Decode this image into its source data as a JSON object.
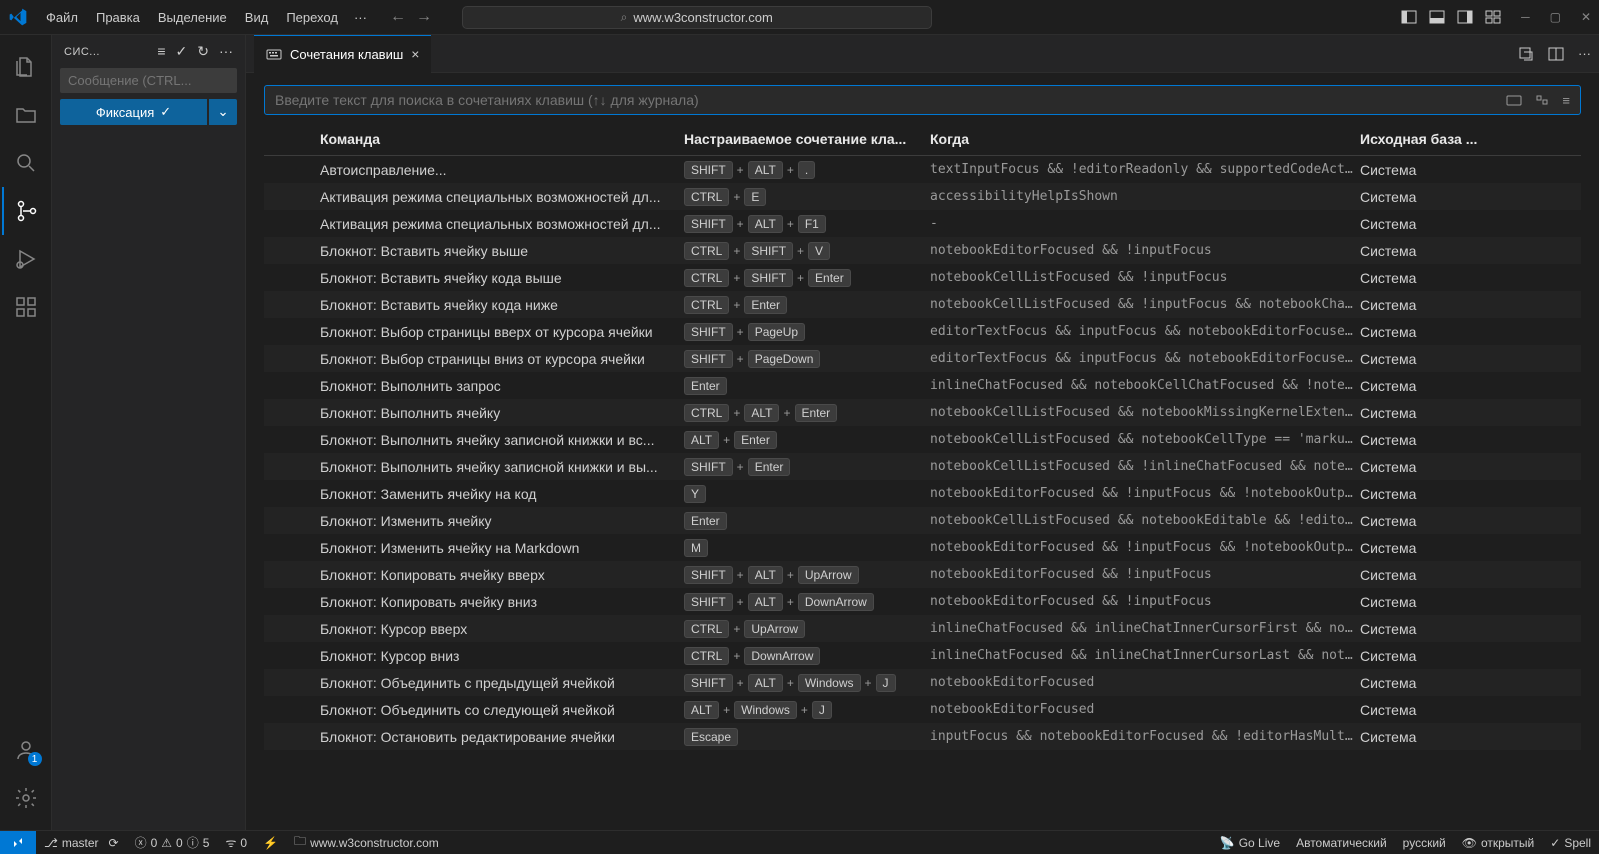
{
  "titlebar": {
    "menu": [
      "Файл",
      "Правка",
      "Выделение",
      "Вид",
      "Переход"
    ],
    "search_text": "www.w3constructor.com"
  },
  "sidebar": {
    "title": "СИС...",
    "message_placeholder": "Сообщение (CTRL...",
    "commit_label": "Фиксация"
  },
  "tab": {
    "label": "Сочетания клавиш"
  },
  "kb_search": {
    "placeholder": "Введите текст для поиска в сочетаниях клавиш (↑↓ для журнала)"
  },
  "headers": {
    "command": "Команда",
    "keybinding": "Настраиваемое сочетание кла...",
    "when": "Когда",
    "source": "Исходная база ..."
  },
  "src_label": "Система",
  "rows": [
    {
      "cmd": "Автоисправление...",
      "keys": [
        "SHIFT",
        "ALT",
        "."
      ],
      "when": "textInputFocus && !editorReadonly && supportedCodeAction..."
    },
    {
      "cmd": "Активация режима специальных возможностей дл...",
      "keys": [
        "CTRL",
        "E"
      ],
      "when": "accessibilityHelpIsShown"
    },
    {
      "cmd": "Активация режима специальных возможностей дл...",
      "keys": [
        "SHIFT",
        "ALT",
        "F1"
      ],
      "when": "-"
    },
    {
      "cmd": "Блокнот: Вставить ячейку выше",
      "keys": [
        "CTRL",
        "SHIFT",
        "V"
      ],
      "when": "notebookEditorFocused && !inputFocus"
    },
    {
      "cmd": "Блокнот: Вставить ячейку кода выше",
      "keys": [
        "CTRL",
        "SHIFT",
        "Enter"
      ],
      "when": "notebookCellListFocused && !inputFocus"
    },
    {
      "cmd": "Блокнот: Вставить ячейку кода ниже",
      "keys": [
        "CTRL",
        "Enter"
      ],
      "when": "notebookCellListFocused && !inputFocus && notebookChatOu..."
    },
    {
      "cmd": "Блокнот: Выбор страницы вверх от курсора ячейки",
      "keys": [
        "SHIFT",
        "PageUp"
      ],
      "when": "editorTextFocus && inputFocus && notebookEditorFocused &..."
    },
    {
      "cmd": "Блокнот: Выбор страницы вниз от курсора ячейки",
      "keys": [
        "SHIFT",
        "PageDown"
      ],
      "when": "editorTextFocus && inputFocus && notebookEditorFocused &..."
    },
    {
      "cmd": "Блокнот: Выполнить запрос",
      "keys": [
        "Enter"
      ],
      "when": "inlineChatFocused && notebookCellChatFocused && !noteboo..."
    },
    {
      "cmd": "Блокнот: Выполнить ячейку",
      "keys": [
        "CTRL",
        "ALT",
        "Enter"
      ],
      "when": "notebookCellListFocused && notebookMissingKernelExtensio..."
    },
    {
      "cmd": "Блокнот: Выполнить ячейку записной книжки и вс...",
      "keys": [
        "ALT",
        "Enter"
      ],
      "when": "notebookCellListFocused && notebookCellType == 'markup' ..."
    },
    {
      "cmd": "Блокнот: Выполнить ячейку записной книжки и вы...",
      "keys": [
        "SHIFT",
        "Enter"
      ],
      "when": "notebookCellListFocused && !inlineChatFocused && noteboo..."
    },
    {
      "cmd": "Блокнот: Заменить ячейку на код",
      "keys": [
        "Y"
      ],
      "when": "notebookEditorFocused && !inputFocus && !notebookOutputF..."
    },
    {
      "cmd": "Блокнот: Изменить ячейку",
      "keys": [
        "Enter"
      ],
      "when": "notebookCellListFocused && notebookEditable && !editorHo..."
    },
    {
      "cmd": "Блокнот: Изменить ячейку на Markdown",
      "keys": [
        "M"
      ],
      "when": "notebookEditorFocused && !inputFocus && !notebookOutputF..."
    },
    {
      "cmd": "Блокнот: Копировать ячейку вверх",
      "keys": [
        "SHIFT",
        "ALT",
        "UpArrow"
      ],
      "when": "notebookEditorFocused && !inputFocus"
    },
    {
      "cmd": "Блокнот: Копировать ячейку вниз",
      "keys": [
        "SHIFT",
        "ALT",
        "DownArrow"
      ],
      "when": "notebookEditorFocused && !inputFocus"
    },
    {
      "cmd": "Блокнот: Курсор вверх",
      "keys": [
        "CTRL",
        "UpArrow"
      ],
      "when": "inlineChatFocused && inlineChatInnerCursorFirst && noteb..."
    },
    {
      "cmd": "Блокнот: Курсор вниз",
      "keys": [
        "CTRL",
        "DownArrow"
      ],
      "when": "inlineChatFocused && inlineChatInnerCursorLast && notebo..."
    },
    {
      "cmd": "Блокнот: Объединить с предыдущей ячейкой",
      "keys": [
        "SHIFT",
        "ALT",
        "Windows",
        "J"
      ],
      "when": "notebookEditorFocused"
    },
    {
      "cmd": "Блокнот: Объединить со следующей ячейкой",
      "keys": [
        "ALT",
        "Windows",
        "J"
      ],
      "when": "notebookEditorFocused"
    },
    {
      "cmd": "Блокнот: Остановить редактирование ячейки",
      "keys": [
        "Escape"
      ],
      "when": "inputFocus && notebookEditorFocused && !editorHasMultipl..."
    }
  ],
  "statusbar": {
    "branch": "master",
    "errors": "0",
    "warnings": "0",
    "infos": "5",
    "ports": "0",
    "path": "www.w3constructor.com",
    "golive": "Go Live",
    "autodetect": "Автоматический",
    "language": "русский",
    "open": "открытый",
    "spell": "Spell"
  }
}
